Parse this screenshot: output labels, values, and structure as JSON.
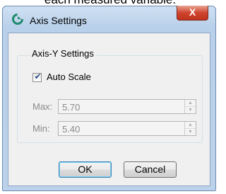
{
  "background": {
    "caption": "each measured variable."
  },
  "window": {
    "title": "Axis Settings",
    "close_glyph": "X"
  },
  "group": {
    "title": "Axis-Y Settings"
  },
  "auto_scale": {
    "label": "Auto Scale",
    "checked": true
  },
  "fields": {
    "max": {
      "label": "Max:",
      "value": "5.70"
    },
    "min": {
      "label": "Min:",
      "value": "5.40"
    }
  },
  "buttons": {
    "ok": "OK",
    "cancel": "Cancel"
  },
  "icons": {
    "app": "app-logo-icon",
    "checkbox": "checkmark-icon",
    "spin_up": "arrow-up-icon",
    "spin_down": "arrow-down-icon"
  }
}
